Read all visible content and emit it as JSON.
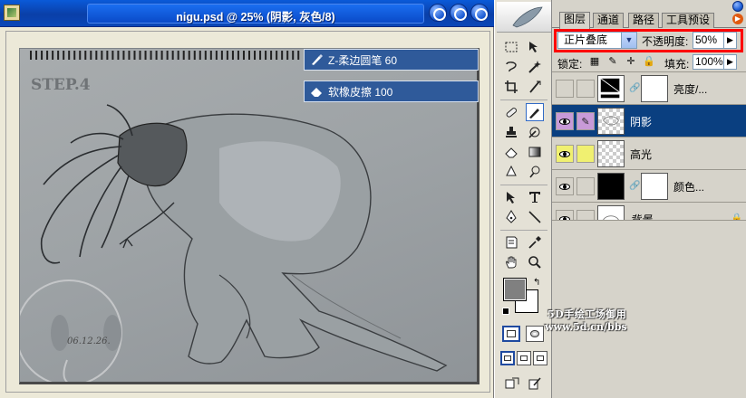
{
  "document": {
    "title": "nigu.psd @ 25% (阴影, 灰色/8)",
    "step_label": "STEP.4",
    "signature_date": "06.12.26."
  },
  "tool_tips": [
    {
      "label": "Z-柔边圆笔 60",
      "icon": "brush-icon"
    },
    {
      "label": "软橡皮擦 100",
      "icon": "eraser-icon"
    }
  ],
  "panel": {
    "tabs": [
      "图层",
      "通道",
      "路径",
      "工具预设"
    ],
    "active_tab": 0,
    "blend_mode": "正片叠底",
    "opacity_label": "不透明度:",
    "opacity_value": "50%",
    "lock_label": "锁定:",
    "fill_label": "填充:",
    "fill_value": "100%",
    "layers": [
      {
        "name": "亮度/...",
        "visible": false,
        "selected": false,
        "type": "adjustment",
        "color": ""
      },
      {
        "name": "阴影",
        "visible": true,
        "selected": true,
        "type": "pixel",
        "color": "violet"
      },
      {
        "name": "高光",
        "visible": true,
        "selected": false,
        "type": "pixel",
        "color": "yellow"
      },
      {
        "name": "颜色...",
        "visible": true,
        "selected": false,
        "type": "fill",
        "color": ""
      },
      {
        "name": "背景",
        "visible": true,
        "selected": false,
        "type": "background",
        "color": ""
      }
    ]
  },
  "colors": {
    "foreground": "#808080",
    "background": "#ffffff",
    "selection": "#0a3f80",
    "highlight_box": "#ff0000"
  },
  "watermark": {
    "line1": "5D手绘工场御用",
    "line2": "www.5d.cn/bbs"
  }
}
